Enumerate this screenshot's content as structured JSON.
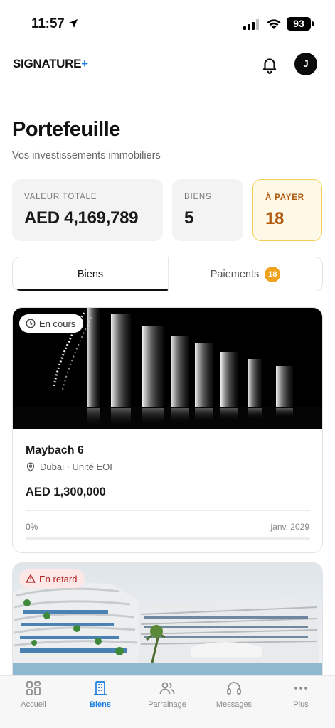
{
  "status_bar": {
    "time": "11:57",
    "battery": "93",
    "icons": [
      "location-arrow-icon",
      "signal-icon",
      "wifi-icon",
      "battery-icon"
    ]
  },
  "header": {
    "logo_text": "SIGNATURE",
    "logo_plus": "+",
    "avatar_initial": "J",
    "icons": [
      "bell-icon"
    ]
  },
  "page": {
    "title": "Portefeuille",
    "subtitle": "Vos investissements immobiliers"
  },
  "stats": {
    "total_label": "VALEUR TOTALE",
    "total_value": "AED 4,169,789",
    "biens_label": "BIENS",
    "biens_value": "5",
    "pay_label": "À PAYER",
    "pay_value": "18"
  },
  "tabs": {
    "biens": "Biens",
    "paiements": "Paiements",
    "paiements_badge": "18",
    "active": "biens"
  },
  "properties": [
    {
      "status": "En cours",
      "status_icon": "clock-icon",
      "name": "Maybach 6",
      "location": "Dubai · Unité EOI",
      "price": "AED 1,300,000",
      "progress_label": "0%",
      "progress": 0,
      "date": "janv. 2029"
    },
    {
      "status": "En retard",
      "status_icon": "warning-icon"
    }
  ],
  "bottom_nav": {
    "items": [
      {
        "label": "Accueil",
        "icon": "grid-icon"
      },
      {
        "label": "Biens",
        "icon": "building-icon"
      },
      {
        "label": "Parrainage",
        "icon": "users-icon"
      },
      {
        "label": "Messages",
        "icon": "headset-icon"
      },
      {
        "label": "Plus",
        "icon": "more-icon"
      }
    ],
    "active": "Biens"
  },
  "colors": {
    "accent": "#1a7fe0",
    "warning_bg": "#fef8e6",
    "warning_text": "#b05a10",
    "badge": "#f0a21c",
    "late_bg": "#fde7e7",
    "late_text": "#b42323"
  }
}
